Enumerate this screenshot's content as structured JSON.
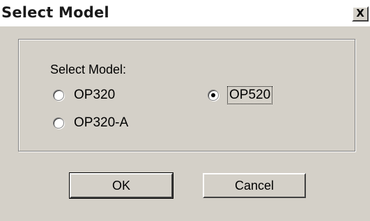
{
  "window": {
    "title": "Select Model",
    "close_glyph": "X"
  },
  "group": {
    "label": "Select Model:"
  },
  "options": [
    {
      "label": "OP320",
      "selected": false
    },
    {
      "label": "OP520",
      "selected": true
    },
    {
      "label": "OP320-A",
      "selected": false
    }
  ],
  "buttons": {
    "ok": "OK",
    "cancel": "Cancel"
  }
}
